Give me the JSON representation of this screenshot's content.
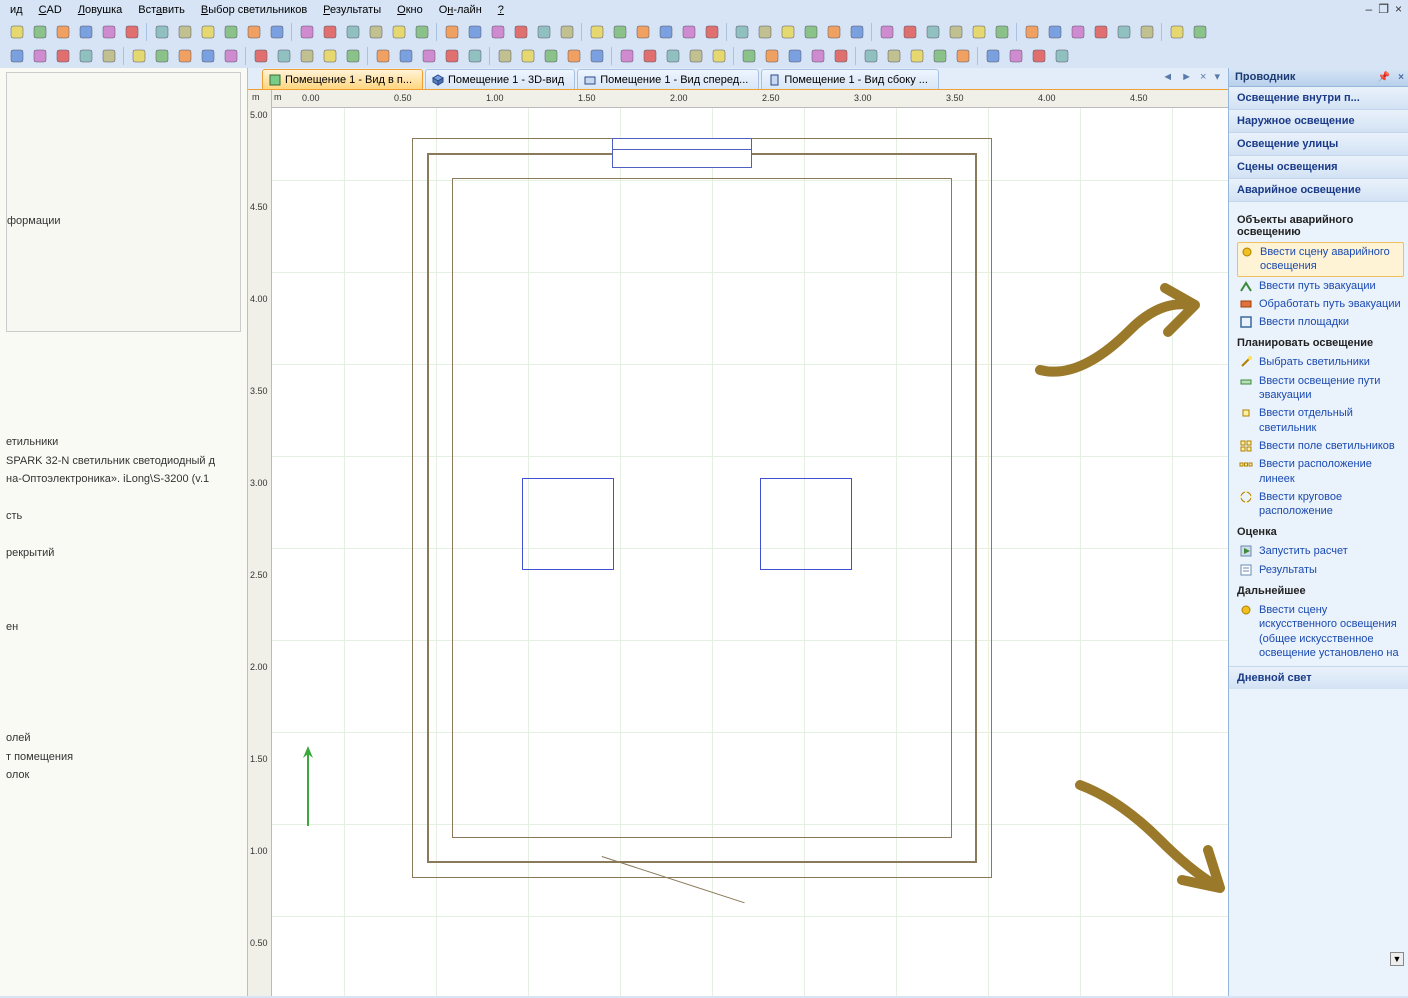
{
  "menu": {
    "items": [
      {
        "pre": "",
        "u": "",
        "post": "ид"
      },
      {
        "pre": "",
        "u": "C",
        "post": "AD"
      },
      {
        "pre": "",
        "u": "Л",
        "post": "овушка"
      },
      {
        "pre": "Вст",
        "u": "а",
        "post": "вить"
      },
      {
        "pre": "",
        "u": "В",
        "post": "ыбор светильников"
      },
      {
        "pre": "",
        "u": "Р",
        "post": "езультаты"
      },
      {
        "pre": "",
        "u": "О",
        "post": "кно"
      },
      {
        "pre": "О",
        "u": "н",
        "post": "-лайн"
      },
      {
        "pre": "",
        "u": "?",
        "post": ""
      }
    ]
  },
  "window_controls": {
    "min": "–",
    "restore": "❐",
    "close": "×"
  },
  "tabs": {
    "items": [
      {
        "label": "Помещение 1 - Вид в п...",
        "active": true,
        "icon": "plan-icon"
      },
      {
        "label": "Помещение 1 - 3D-вид",
        "active": false,
        "icon": "cube-icon"
      },
      {
        "label": "Помещение 1 - Вид сперед...",
        "active": false,
        "icon": "front-icon"
      },
      {
        "label": "Помещение 1 - Вид сбоку ...",
        "active": false,
        "icon": "side-icon"
      }
    ],
    "nav": {
      "prev": "◄",
      "next": "►",
      "close": "×",
      "more": "▾"
    }
  },
  "ruler": {
    "h": [
      "0.00",
      "0.50",
      "1.00",
      "1.50",
      "2.00",
      "2.50",
      "3.00",
      "3.50",
      "4.00",
      "4.50"
    ],
    "v": [
      "5.00",
      "4.50",
      "4.00",
      "3.50",
      "3.00",
      "2.50",
      "2.00",
      "1.50",
      "1.00",
      "0.50"
    ],
    "unit": "m"
  },
  "left": {
    "info_label": "формации",
    "tree": [
      "етильники",
      "SPARK 32-N светильник светодиодный д",
      "на-Оптоэлектроника». iLong\\S-3200 (v.1",
      "",
      "сть",
      "",
      "рекрытий",
      "",
      "",
      "",
      "ен",
      "",
      "",
      "",
      "",
      "",
      "олей",
      "т помещения",
      "олок"
    ]
  },
  "explorer": {
    "title": "Проводник",
    "collapsed": [
      "Освещение внутри п...",
      "Наружное освещение",
      "Освещение улицы",
      "Сцены освещения",
      "Аварийное освещение"
    ],
    "section1": {
      "title": "Объекты аварийного освещению",
      "items": [
        {
          "label": "Ввести сцену аварийного освещения",
          "selected": true,
          "icon": "bullet-yellow-icon"
        },
        {
          "label": "Ввести путь эвакуации",
          "icon": "path-icon"
        },
        {
          "label": "Обработать путь эвакуации",
          "icon": "process-icon"
        },
        {
          "label": "Ввести площадки",
          "icon": "area-icon"
        }
      ]
    },
    "section2": {
      "title": "Планировать освещение",
      "items": [
        {
          "label": "Выбрать светильники",
          "icon": "wand-icon"
        },
        {
          "label": "Ввести освещение пути эвакуации",
          "icon": "path-light-icon"
        },
        {
          "label": "Ввести отдельный светильник",
          "icon": "single-lum-icon"
        },
        {
          "label": "Ввести поле светильников",
          "icon": "grid-lum-icon"
        },
        {
          "label": "Ввести расположение линеек",
          "icon": "line-lum-icon"
        },
        {
          "label": "Ввести круговое расположение",
          "icon": "circle-lum-icon"
        }
      ]
    },
    "section3": {
      "title": "Оценка",
      "items": [
        {
          "label": "Запустить расчет",
          "icon": "run-icon"
        },
        {
          "label": "Результаты",
          "icon": "results-icon"
        }
      ]
    },
    "section4": {
      "title": "Дальнейшее",
      "items": [
        {
          "label": "Ввести сцену искусственного освещения (общее искусственное освещение установлено на",
          "icon": "bullet-yellow-icon"
        }
      ]
    },
    "footer": "Дневной свет"
  },
  "toolbar_icons_row1_count": 50,
  "toolbar_icons_row2_count": 44,
  "annotations": {
    "arrow1_desc": "hand-drawn-arrow-pointing-to-insert-emergency-scene",
    "arrow2_desc": "hand-drawn-arrow-pointing-to-insert-artificial-scene"
  }
}
